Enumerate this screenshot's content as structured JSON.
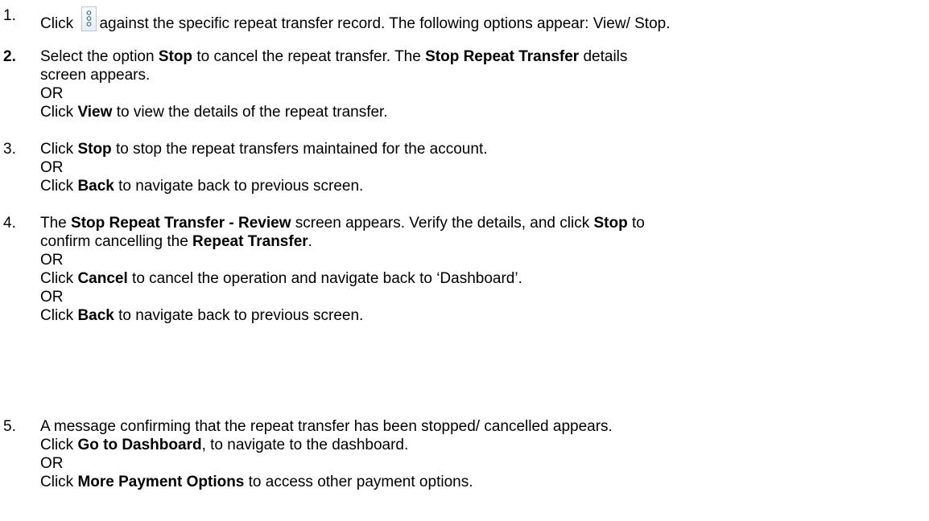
{
  "steps": [
    {
      "number": "1.",
      "text_a": "Click ",
      "icon": "kebab-menu-icon",
      "text_b": "against the specific repeat transfer record. The following options appear: View/ Stop."
    },
    {
      "number": "2.",
      "l1_a": "Select the option ",
      "l1_b": "Stop",
      "l1_c": " to cancel the repeat transfer. The ",
      "l1_d": "Stop Repeat Transfer",
      "l1_e": " details",
      "l2": "screen appears.",
      "l3": "OR",
      "l4_a": "Click ",
      "l4_b": "View",
      "l4_c": " to view the details of the repeat transfer."
    },
    {
      "number": "3.",
      "l1_a": "Click ",
      "l1_b": "Stop",
      "l1_c": " to stop the repeat transfers maintained for the account.",
      "l2": "OR",
      "l3_a": "Click ",
      "l3_b": "Back",
      "l3_c": " to navigate back to previous screen."
    },
    {
      "number": "4.",
      "l1_a": "The ",
      "l1_b": "Stop Repeat Transfer - Review",
      "l1_c": " screen appears. Verify the details, and click ",
      "l1_d": "Stop",
      "l1_e": " to",
      "l2_a": "confirm cancelling the ",
      "l2_b": "Repeat Transfer",
      "l2_c": ".",
      "l3": "OR",
      "l4_a": "Click ",
      "l4_b": "Cancel",
      "l4_c": " to cancel the operation and navigate back to ‘Dashboard’.",
      "l5": "OR",
      "l6_a": "Click ",
      "l6_b": "Back",
      "l6_c": " to navigate back to previous screen."
    },
    {
      "number": "5.",
      "l1": "A message confirming that the repeat transfer has been stopped/ cancelled appears.",
      "l2_a": "Click ",
      "l2_b": "Go to Dashboard",
      "l2_c": ", to navigate to the dashboard.",
      "l3": "OR",
      "l4_a": "Click ",
      "l4_b": "More Payment Options",
      "l4_c": " to access other payment options."
    }
  ]
}
